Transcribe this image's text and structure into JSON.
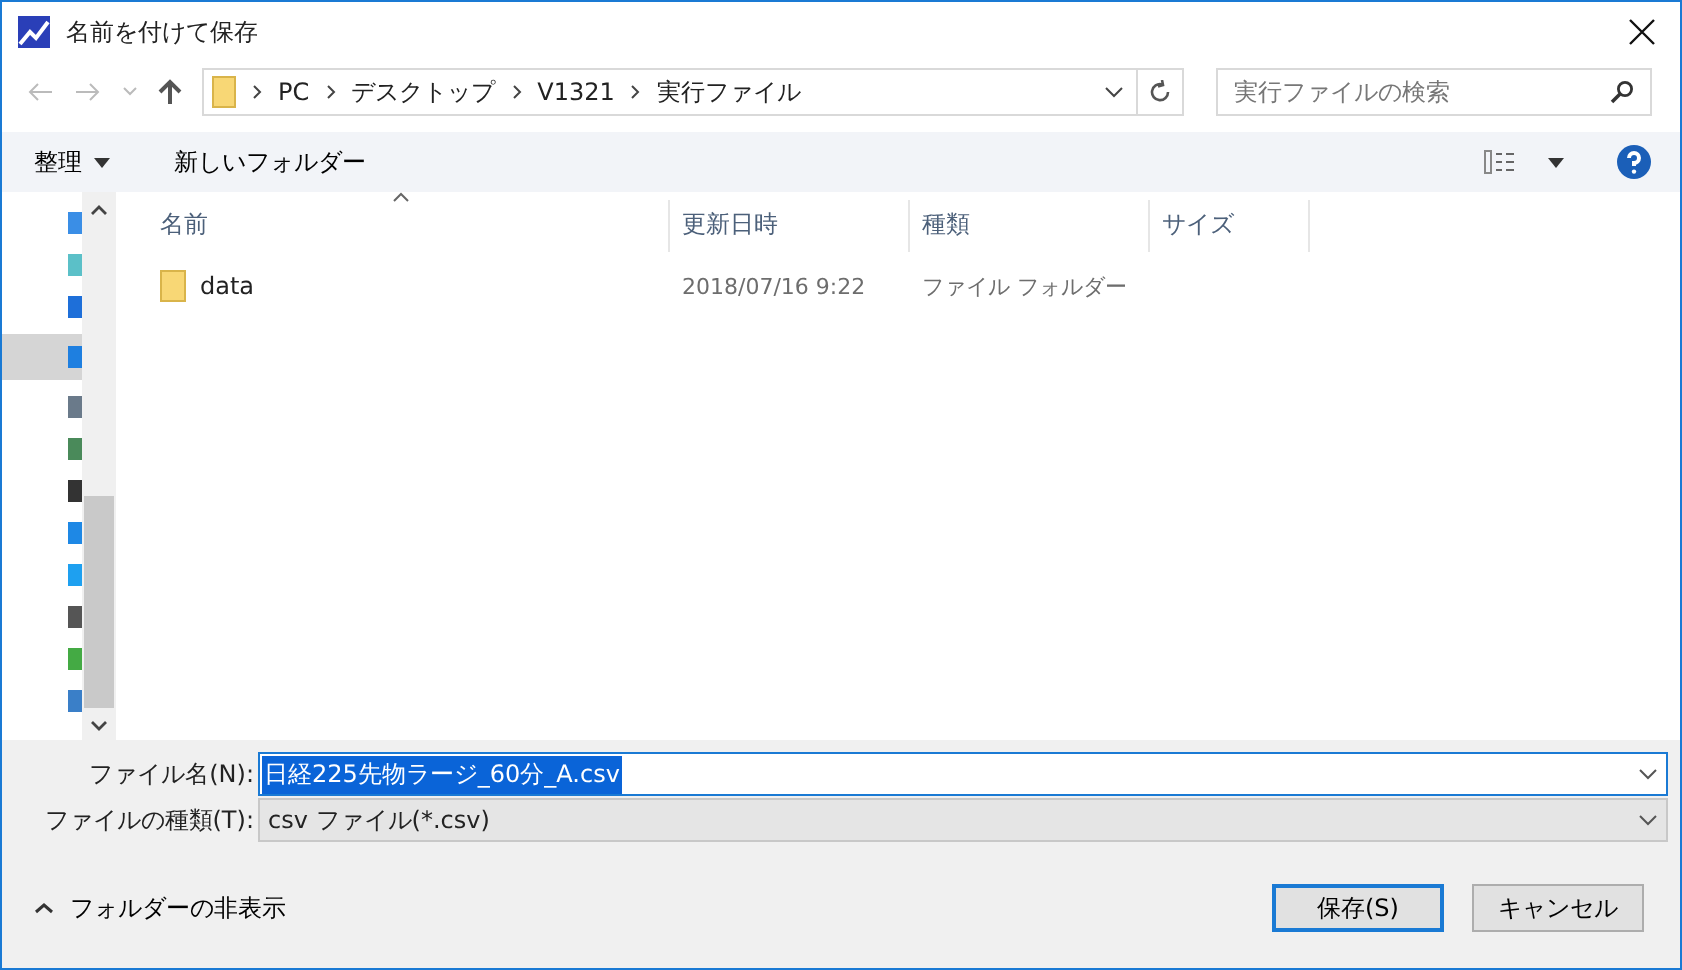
{
  "window": {
    "title": "名前を付けて保存"
  },
  "breadcrumb": [
    "PC",
    "デスクトップ",
    "V1321",
    "実行ファイル"
  ],
  "search": {
    "placeholder": "実行ファイルの検索"
  },
  "toolbar": {
    "organize": "整理",
    "new_folder": "新しいフォルダー"
  },
  "nav_items": [
    {
      "kind": "monitor",
      "selected": false
    },
    {
      "kind": "cube",
      "selected": false
    },
    {
      "kind": "download",
      "selected": false
    },
    {
      "kind": "desktop",
      "selected": true
    },
    {
      "kind": "document",
      "selected": false
    },
    {
      "kind": "image",
      "selected": false
    },
    {
      "kind": "film",
      "selected": false
    },
    {
      "kind": "cloud",
      "selected": false
    },
    {
      "kind": "windows",
      "selected": false
    },
    {
      "kind": "drive",
      "selected": false
    },
    {
      "kind": "netdrive",
      "selected": false
    },
    {
      "kind": "network",
      "selected": false
    }
  ],
  "table": {
    "columns": [
      {
        "label": "名前",
        "sorted": true
      },
      {
        "label": "更新日時",
        "sorted": false
      },
      {
        "label": "種類",
        "sorted": false
      },
      {
        "label": "サイズ",
        "sorted": false
      }
    ],
    "rows": [
      {
        "name": "data",
        "modified": "2018/07/16 9:22",
        "type": "ファイル フォルダー",
        "size": ""
      }
    ]
  },
  "file_name": {
    "label": "ファイル名(N):",
    "value": "日経225先物ラージ_60分_A.csv"
  },
  "file_type": {
    "label": "ファイルの種類(T):",
    "value": "csv ファイル(*.csv)"
  },
  "hide_folders": "フォルダーの非表示",
  "buttons": [
    {
      "label": "保存(S)",
      "default": true
    },
    {
      "label": "キャンセル",
      "default": false
    }
  ]
}
